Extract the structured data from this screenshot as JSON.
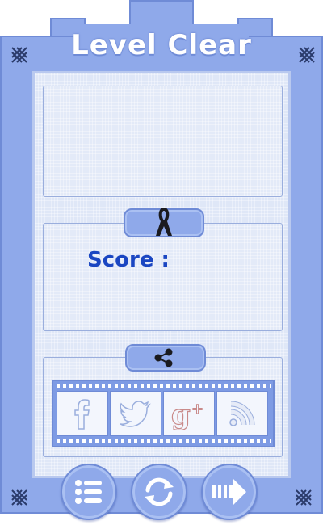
{
  "title": "Level Clear",
  "score": {
    "label": "Score :"
  },
  "icons": {
    "ribbon": "ribbon-icon",
    "share": "share-icon",
    "facebook": "facebook-icon",
    "twitter": "twitter-icon",
    "googleplus": "google-plus-icon",
    "rss": "rss-icon",
    "menu": "menu-list-icon",
    "restart": "restart-icon",
    "next": "next-arrow-icon"
  },
  "colors": {
    "frame": "#8fa9ea",
    "frame_border": "#6f8bd6",
    "score_text": "#1a46c2",
    "title_text": "#ffffff"
  }
}
